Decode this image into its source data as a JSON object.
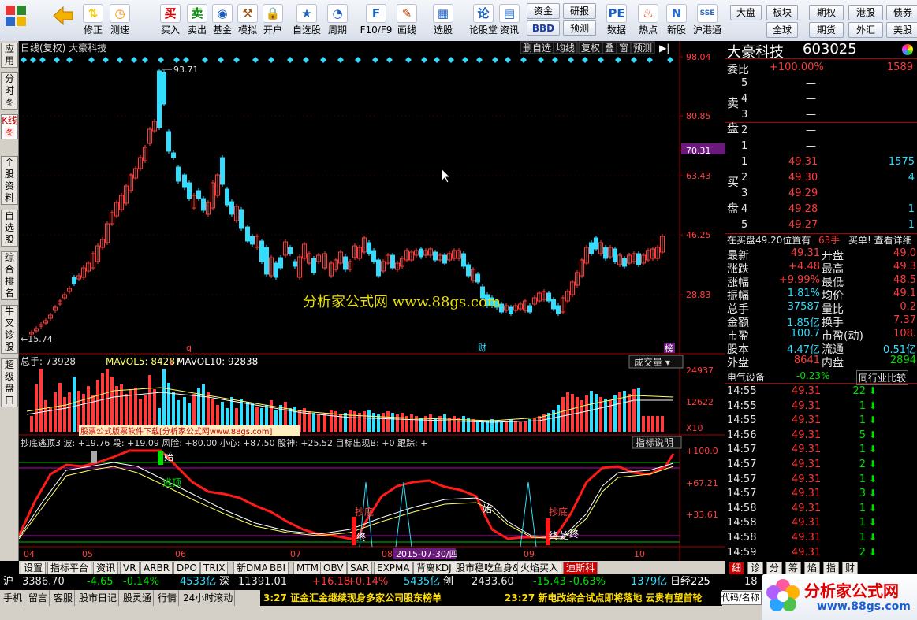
{
  "toolbar": {
    "buttons": [
      {
        "label": "",
        "icon": "app-grid-icon"
      },
      {
        "label": "",
        "icon": "back-arrow-icon"
      },
      {
        "label": "修正",
        "icon": "up-down-icon"
      },
      {
        "label": "测速",
        "icon": "clock-icon"
      },
      {
        "label": "买入",
        "icon": "buy-icon",
        "glyph": "买"
      },
      {
        "label": "卖出",
        "icon": "sell-icon",
        "glyph": "卖"
      },
      {
        "label": "基金",
        "icon": "fund-icon"
      },
      {
        "label": "模拟",
        "icon": "hammer-icon"
      },
      {
        "label": "开户",
        "icon": "lock-icon"
      },
      {
        "label": "自选股",
        "icon": "star-list-icon"
      },
      {
        "label": "周期",
        "icon": "period-icon"
      },
      {
        "label": "F10/F9",
        "icon": "f10-icon"
      },
      {
        "label": "画线",
        "icon": "pen-icon"
      },
      {
        "label": "选股",
        "icon": "screen-icon"
      },
      {
        "label": "论股堂",
        "icon": "forum-icon",
        "glyph": "论"
      },
      {
        "label": "资讯",
        "icon": "news-icon"
      },
      {
        "label": "数据",
        "icon": "pe-icon",
        "glyph": "PE"
      },
      {
        "label": "热点",
        "icon": "fire-icon"
      },
      {
        "label": "新股",
        "icon": "ipo-icon"
      },
      {
        "label": "沪港通",
        "icon": "sse-hke-icon",
        "glyph": "SSE"
      }
    ],
    "small": [
      {
        "label": "资金"
      },
      {
        "label": "BBD"
      },
      {
        "label": "研报"
      },
      {
        "label": "预测"
      },
      {
        "label": "大盘"
      },
      {
        "label": "板块"
      },
      {
        "label": "全球"
      },
      {
        "label": "期权"
      },
      {
        "label": "期货"
      },
      {
        "label": "港股"
      },
      {
        "label": "外汇"
      },
      {
        "label": "债券"
      },
      {
        "label": "美股"
      }
    ]
  },
  "vtabs": [
    "应用",
    "分时图",
    "K线图",
    "个股资料",
    "自选股",
    "综合排名",
    "牛叉诊股",
    "超级盘口"
  ],
  "chart": {
    "title": "日线(复权)  大豪科技",
    "buttons": [
      "删自选",
      "均线",
      "复权",
      "叠",
      "窗",
      "预测"
    ],
    "price_labels": [
      "98.04",
      "80.85",
      "70.31",
      "63.43",
      "46.25",
      "28.83"
    ],
    "high_label": "93.71",
    "low_label": "15.74",
    "watermark": "分析家公式网   www.88gs.com",
    "event_markers": [
      "q",
      "财",
      "榜"
    ],
    "vol_header": {
      "total": "总手: 73928",
      "mavol5": "MAVOL5: 84287",
      "mavol10": "MAVOL10: 92838"
    },
    "vol_select": "成交量",
    "vol_labels": [
      "24937",
      "12622",
      "X10"
    ],
    "ad_banner": "股票公式版票软件下载[分析家公式网www.88gs.com]",
    "ind_header": "抄底逃顶3 波: +19.76   段: +19.09   风险: +80.00  小心: +87.50   股神: +25.52   目标出现B: +0   跟踪: +",
    "ind_btn": "指标说明",
    "ind_labels": [
      "+100.0",
      "+67.21",
      "+33.61"
    ],
    "ind_text": [
      "逃顶",
      "抄底",
      "始",
      "终",
      "始",
      "终"
    ],
    "date_labels": [
      "04",
      "05",
      "06",
      "07",
      "08",
      "09",
      "10"
    ],
    "date_cursor": "2015-07-30/四"
  },
  "chart_data": {
    "type": "line",
    "title": "日线(复权) 大豪科技",
    "ylim": [
      15.74,
      98.04
    ],
    "price_marks": [
      15.74,
      28.83,
      46.25,
      63.43,
      70.31,
      80.85,
      93.71,
      98.04
    ],
    "volume": {
      "total": 73928,
      "mavol5": 84287,
      "mavol10": 92838,
      "max_label": 24937,
      "mid_label": 12622
    },
    "indicator": {
      "name": "抄底逃顶3",
      "wave": 19.76,
      "segment": 19.09,
      "risk": 80.0,
      "caution": 87.5,
      "stock_god": 25.52,
      "target_B": 0
    },
    "x_ticks": [
      "04",
      "05",
      "06",
      "07",
      "08",
      "09",
      "10"
    ]
  },
  "quote": {
    "name": "大豪科技",
    "code": "603025",
    "weibi_label": "委比",
    "weibi": "+100.00%",
    "weicha": "1589",
    "sell_label": "卖盘",
    "sells": [
      {
        "n": "5",
        "p": "—",
        "v": ""
      },
      {
        "n": "4",
        "p": "—",
        "v": ""
      },
      {
        "n": "3",
        "p": "—",
        "v": ""
      },
      {
        "n": "2",
        "p": "—",
        "v": ""
      },
      {
        "n": "1",
        "p": "—",
        "v": ""
      }
    ],
    "buy_label": "买盘",
    "buys": [
      {
        "n": "1",
        "p": "49.31",
        "v": "1575"
      },
      {
        "n": "2",
        "p": "49.30",
        "v": "4"
      },
      {
        "n": "3",
        "p": "49.29",
        "v": ""
      },
      {
        "n": "4",
        "p": "49.28",
        "v": "1"
      },
      {
        "n": "5",
        "p": "49.27",
        "v": "1"
      }
    ],
    "pos_line": "在买盘49.20位置有",
    "pos_qty": "63手",
    "pos_link": "买单! 查看详细",
    "stats": [
      {
        "l1": "最新",
        "v1": "49.31",
        "l2": "开盘",
        "v2": "49.0"
      },
      {
        "l1": "涨跌",
        "v1": "+4.48",
        "l2": "最高",
        "v2": "49.3"
      },
      {
        "l1": "涨幅",
        "v1": "+9.99%",
        "l2": "最低",
        "v2": "48.5"
      },
      {
        "l1": "振幅",
        "v1": "1.81%",
        "l2": "均价",
        "v2": "49.1"
      },
      {
        "l1": "总手",
        "v1": "37587",
        "l2": "量比",
        "v2": "0.2"
      },
      {
        "l1": "金额",
        "v1": "1.85亿",
        "l2": "换手",
        "v2": "7.37"
      },
      {
        "l1": "市盈",
        "v1": "100.7",
        "l2": "市盈(动)",
        "v2": "108."
      },
      {
        "l1": "股本",
        "v1": "4.47亿",
        "l2": "流通",
        "v2": "0.51亿"
      },
      {
        "l1": "外盘",
        "v1": "8641",
        "l2": "内盘",
        "v2": "2894"
      }
    ],
    "industry": "电气设备",
    "industry_chg": "-0.23%",
    "industry_btn": "同行业比较",
    "ticks": [
      {
        "t": "14:55",
        "p": "49.31",
        "v": "22"
      },
      {
        "t": "14:55",
        "p": "49.31",
        "v": "1"
      },
      {
        "t": "14:55",
        "p": "49.31",
        "v": "1"
      },
      {
        "t": "14:56",
        "p": "49.31",
        "v": "5"
      },
      {
        "t": "14:57",
        "p": "49.31",
        "v": "1"
      },
      {
        "t": "14:57",
        "p": "49.31",
        "v": "2"
      },
      {
        "t": "14:57",
        "p": "49.31",
        "v": "1"
      },
      {
        "t": "14:57",
        "p": "49.31",
        "v": "3"
      },
      {
        "t": "14:58",
        "p": "49.31",
        "v": "1"
      },
      {
        "t": "14:58",
        "p": "49.31",
        "v": "1"
      },
      {
        "t": "14:58",
        "p": "49.31",
        "v": "1"
      },
      {
        "t": "14:59",
        "p": "49.31",
        "v": "2"
      }
    ]
  },
  "btabs": [
    "设置",
    "指标平台",
    "资讯",
    "VR",
    "ARBR",
    "DPO",
    "TRIX",
    "新DMA",
    "BBI",
    "MTM",
    "OBV",
    "SAR",
    "EXPMA",
    "背离KDJ",
    "股市稳吃鱼身&林永",
    "火焰买入",
    "迪斯科"
  ],
  "rtabs": [
    "细",
    "诊",
    "分",
    "筹",
    "焰",
    "指",
    "财"
  ],
  "status": {
    "sh": "沪",
    "sh_idx": "3386.70",
    "sh_chg": "-4.65",
    "sh_pct": "-0.14%",
    "sh_amt": "4533亿",
    "sz": "深",
    "sz_idx": "11391.01",
    "sz_chg": "+16.18",
    "sz_pct": "+0.14%",
    "sz_amt": "5435亿",
    "cy": "创",
    "cy_idx": "2433.60",
    "cy_chg": "-15.43",
    "cy_pct": "-0.63%",
    "cy_amt": "1379亿",
    "rj": "日经225",
    "rj_val": "18"
  },
  "status2": {
    "items": [
      "手机",
      "留言",
      "客服",
      "股市日记",
      "股灵通",
      "行情",
      "24小时滚动"
    ],
    "news1": "3:27 证金汇金继续现身多家公司股东榜单",
    "news2": "23:27 新电改综合试点即将落地  云贵有望首轮",
    "code_box": "代码/名称"
  },
  "logo": {
    "text": "分析家公式网",
    "url": "www.88gs.com"
  },
  "colors": {
    "up": "#ff3b3b",
    "down": "#33ddff",
    "bg": "#000000"
  }
}
